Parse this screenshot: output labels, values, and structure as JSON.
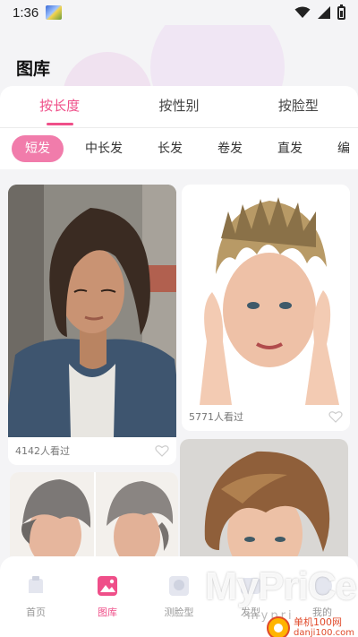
{
  "status": {
    "time": "1:36"
  },
  "header": {
    "title": "图库"
  },
  "tabs": [
    {
      "label": "按长度",
      "active": true
    },
    {
      "label": "按性别",
      "active": false
    },
    {
      "label": "按脸型",
      "active": false
    }
  ],
  "chips": [
    {
      "label": "短发",
      "active": true
    },
    {
      "label": "中长发"
    },
    {
      "label": "长发"
    },
    {
      "label": "卷发"
    },
    {
      "label": "直发"
    },
    {
      "label": "编"
    }
  ],
  "cards": [
    {
      "views": "4142人看过"
    },
    {
      "views": "5771人看过"
    },
    {
      "views": ""
    },
    {
      "views": ""
    }
  ],
  "nav": [
    {
      "label": "首页",
      "icon": "home-icon",
      "active": false
    },
    {
      "label": "图库",
      "icon": "gallery-icon",
      "active": true
    },
    {
      "label": "测脸型",
      "icon": "face-scan-icon",
      "active": false
    },
    {
      "label": "发型",
      "icon": "hairstyle-icon",
      "active": false
    },
    {
      "label": "我的",
      "icon": "profile-icon",
      "active": false
    }
  ],
  "watermark": {
    "brand": "MyPriCe",
    "sub": "mypri",
    "cn": "单机100网",
    "domain": "danji100.com"
  },
  "colors": {
    "accent": "#ef4f89",
    "chip_active": "#f17cab"
  }
}
